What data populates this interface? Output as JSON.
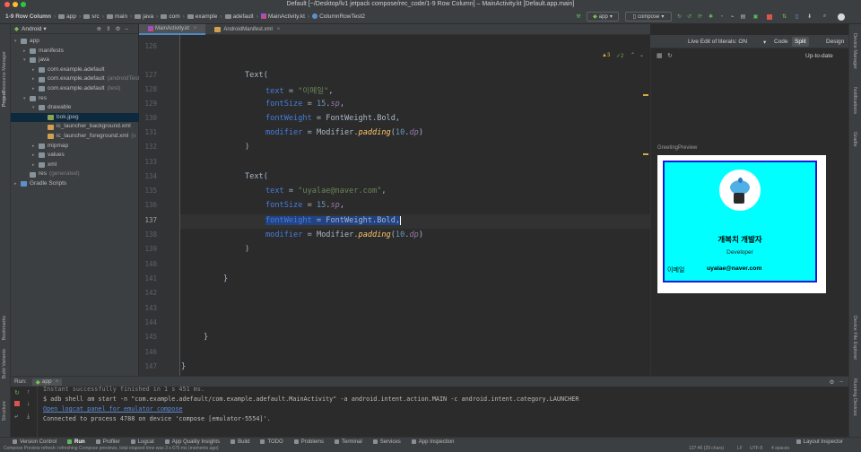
{
  "window": {
    "title": "Default [~/Desktop/lv1 jetpack compose/rec_code/1-9 Row Column] – MainActivity.kt [Default.app.main]"
  },
  "breadcrumbs": [
    "1-9 Row Column",
    "app",
    "src",
    "main",
    "java",
    "com",
    "example",
    "adefault",
    "MainActivity.kt",
    "ColumnRowTest2"
  ],
  "toolbar": {
    "run_config": "app",
    "device": "compose"
  },
  "project_panel": {
    "view_selector": "Android",
    "items": [
      {
        "label": "app",
        "hint": "",
        "indent": 0,
        "arrow": "▾",
        "icon": "folder"
      },
      {
        "label": "manifests",
        "hint": "",
        "indent": 1,
        "arrow": "▸",
        "icon": "folder"
      },
      {
        "label": "java",
        "hint": "",
        "indent": 1,
        "arrow": "▾",
        "icon": "folder"
      },
      {
        "label": "com.example.adefault",
        "hint": "",
        "indent": 2,
        "arrow": "▸",
        "icon": "folder"
      },
      {
        "label": "com.example.adefault",
        "hint": "(androidTest)",
        "indent": 2,
        "arrow": "▸",
        "icon": "folder"
      },
      {
        "label": "com.example.adefault",
        "hint": "(test)",
        "indent": 2,
        "arrow": "▸",
        "icon": "folder"
      },
      {
        "label": "res",
        "hint": "",
        "indent": 1,
        "arrow": "▾",
        "icon": "folder"
      },
      {
        "label": "drawable",
        "hint": "",
        "indent": 2,
        "arrow": "▾",
        "icon": "folder"
      },
      {
        "label": "bok.jpeg",
        "hint": "",
        "indent": 3,
        "arrow": "",
        "icon": "image"
      },
      {
        "label": "ic_launcher_background.xml",
        "hint": "",
        "indent": 3,
        "arrow": "",
        "icon": "xml"
      },
      {
        "label": "ic_launcher_foreground.xml",
        "hint": "(v",
        "indent": 3,
        "arrow": "",
        "icon": "xml"
      },
      {
        "label": "mipmap",
        "hint": "",
        "indent": 2,
        "arrow": "▸",
        "icon": "folder"
      },
      {
        "label": "values",
        "hint": "",
        "indent": 2,
        "arrow": "▸",
        "icon": "folder"
      },
      {
        "label": "xml",
        "hint": "",
        "indent": 2,
        "arrow": "▸",
        "icon": "folder"
      },
      {
        "label": "res",
        "hint": "(generated)",
        "indent": 1,
        "arrow": "",
        "icon": "folder"
      },
      {
        "label": "Gradle Scripts",
        "hint": "",
        "indent": 0,
        "arrow": "▸",
        "icon": "gradle"
      }
    ]
  },
  "editor_tabs": [
    {
      "label": "MainActivity.kt",
      "active": true
    },
    {
      "label": "AndroidManifest.xml",
      "active": false
    }
  ],
  "editor": {
    "warnings": "▲3",
    "weak_warnings": "✓2",
    "line_numbers": [
      "126",
      "127",
      "128",
      "129",
      "130",
      "131",
      "132",
      "133",
      "134",
      "135",
      "136",
      "137",
      "138",
      "139",
      "140",
      "141",
      "142",
      "143",
      "144",
      "145",
      "146",
      "147"
    ],
    "code": {
      "l127": "Text(",
      "l128_param": "text",
      "l128_str": "\"이메일\"",
      "l129_param": "fontSize",
      "l129_num": "15",
      "l129_unit": "sp",
      "l130_param": "fontWeight",
      "l130_val": "FontWeight.Bold,",
      "l131_param": "modifier",
      "l131_recv": "Modifier.",
      "l131_fn": "padding",
      "l131_num": "10",
      "l131_unit": "dp",
      "l132": ")",
      "l134": "Text(",
      "l135_param": "text",
      "l135_str": "\"uyalae@naver.com\"",
      "l136_param": "fontSize",
      "l136_num": "15",
      "l136_unit": "sp",
      "l137_param": "fontWeight",
      "l137_val": "FontWeight.Bold,",
      "l138_param": "modifier",
      "l138_recv": "Modifier.",
      "l138_fn": "padding",
      "l138_num": "10",
      "l138_unit": "dp",
      "l139": ")",
      "l141": "}",
      "l144": "}",
      "l147": "}"
    }
  },
  "editor_view_modes": {
    "live_edit": "Live Edit of literals: ON",
    "code": "Code",
    "split": "Split",
    "design": "Design"
  },
  "preview": {
    "status": "Up-to-date",
    "title": "GreetingPreview",
    "name": "개복치 개발자",
    "role": "Developer",
    "email_label": "이메일",
    "email": "uyalae@naver.com",
    "card_bg": "#00ffff",
    "card_border": "#1a1ad8"
  },
  "run_panel": {
    "tab_label": "Run:",
    "config": "app",
    "lines": [
      "Instant successfully finished in 1 s 451 ms.",
      "$ adb shell am start -n \"com.example.adefault/com.example.adefault.MainActivity\" -a android.intent.action.MAIN -c android.intent.category.LAUNCHER",
      "Open logcat panel for emulator compose",
      "Connected to process 4788 on device 'compose [emulator-5554]'."
    ]
  },
  "bottom_tools": [
    "Version Control",
    "Run",
    "Profiler",
    "Logcat",
    "App Quality Insights",
    "Build",
    "TODO",
    "Problems",
    "Terminal",
    "Services",
    "App Inspection"
  ],
  "bottom_right_tool": "Layout Inspector",
  "left_strip": [
    "Resource Manager",
    "Project",
    "Bookmarks",
    "Build Variants",
    "Structure"
  ],
  "right_strip": [
    "Device Manager",
    "Notifications",
    "Gradle",
    "Device File Explorer",
    "Running Devices"
  ],
  "status": {
    "message": "Compose Preview refresh: refreshing Compose previews, total elapsed time was 3 s 675 ms (moments ago)",
    "position": "137:46 (29 chars)",
    "line_sep": "LF",
    "encoding": "UTF-8",
    "indent": "4 spaces"
  },
  "colors": {
    "accent": "#4a88c7",
    "selection": "#214283"
  }
}
